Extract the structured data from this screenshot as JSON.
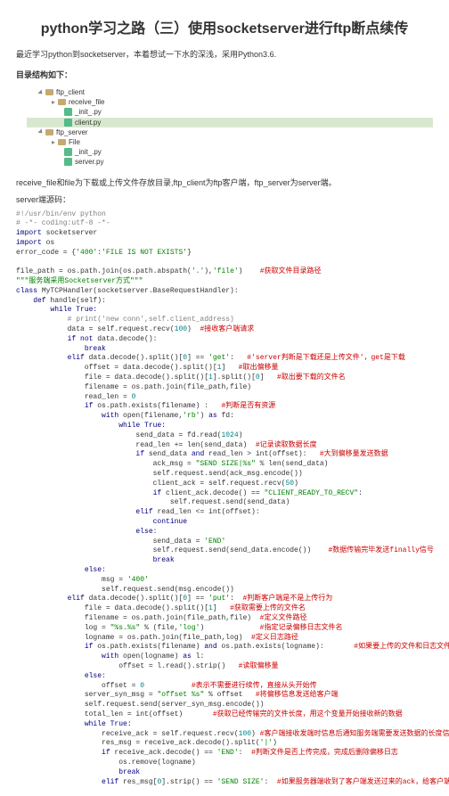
{
  "title": "python学习之路（三）使用socketserver进行ftp断点续传",
  "desc": "最近学习python到socketserver，本着想试一下水的深浅，采用Python3.6.",
  "struct_label": "目录结构如下：",
  "tree": {
    "root": "ftp_client",
    "recv": "receive_file",
    "init1": "_init_.py",
    "client": "client.py",
    "srv_root": "ftp_server",
    "file": "File",
    "init2": "_init_.py",
    "server": "server.py"
  },
  "caption": "receive_file和file为下载或上传文件存放目录,ftp_client为ftp客户端，ftp_server为server端。",
  "server_label": "server端源码：",
  "c": {
    "l1": "#!/usr/bin/env python",
    "l2": "# -*- coding:utf-8 -*-",
    "l3": "import",
    "l3b": " socketserver",
    "l4": "import",
    "l4b": " os",
    "l5a": "error_code = {",
    "l5b": "'400'",
    "l5c": ":",
    "l5d": "'FILE IS NOT EXISTS'",
    "l5e": "}",
    "l6a": "file_path = os.path.join(os.path.abspath(",
    "l6b": "'.'",
    "l6c": "),",
    "l6d": "'file'",
    "l6e": ")    ",
    "l6f": "#获取文件目录路径",
    "l7": "\"\"\"服务端采用Socketserver方式\"\"\"",
    "l8a": "class ",
    "l8b": "MyTCPHandler",
    "l8c": "(socketserver.BaseRequestHandler):",
    "l9a": "    def ",
    "l9b": "handle",
    "l9c": "(self):",
    "l10": "        while True:",
    "l11": "            # print('new conn',self.client_address)",
    "l12a": "            data = self.request.recv(",
    "l12b": "100",
    "l12c": ")  ",
    "l12d": "#接收客户端请求",
    "l13": "            if not ",
    "l13b": "data.decode():",
    "l14": "                break",
    "l15": "            elif ",
    "l15b": "data.decode().split()[",
    "l15c": "0",
    "l15d": "] == ",
    "l15e": "'get'",
    "l15f": ":   ",
    "l15g": "#'server判断是下载还是上传文件'，get是下载",
    "l16": "                offset = data.decode().split()[",
    "l16c": "1",
    "l16d": "]   ",
    "l16e": "#取出偏移量",
    "l17": "                file = data.decode().split()[",
    "l17c": "1",
    "l17d": "].split()[",
    "l17e": "0",
    "l17f": "]   ",
    "l17g": "#取出要下载的文件名",
    "l18": "                filename = os.path.join(file_path,file)",
    "l19": "                read_len = ",
    "l19b": "0",
    "l20": "                if ",
    "l20b": "os.path.exists(filename) :   ",
    "l20c": "#判断是否有资源",
    "l21": "                    with ",
    "l21b": "open(filename,",
    "l21c": "'rb'",
    "l21d": ") ",
    "l21e": "as ",
    "l21f": "fd:",
    "l22": "                        while True:",
    "l23": "                            send_data = fd.read(",
    "l23b": "1024",
    "l23c": ")",
    "l24": "                            read_len += len(send_data)  ",
    "l24b": "#记录读取数据长度",
    "l25": "                            if ",
    "l25b": "send_data ",
    "l25c": "and ",
    "l25d": "read_len > int(offset):   ",
    "l25e": "#大到偏移量发送数据",
    "l26": "                                ack_msg = ",
    "l26b": "\"SEND SIZE|%s\" ",
    "l26c": "% len(send_data)",
    "l27": "                                self.request.send(ack_msg.encode())",
    "l28": "                                client_ack = self.request.recv(",
    "l28b": "50",
    "l28c": ")",
    "l29": "                                if ",
    "l29b": "client_ack.decode() == ",
    "l29c": "\"CLIENT_READY_TO_RECV\"",
    "l29d": ":",
    "l30": "                                    self.request.send(send_data)",
    "l31": "                            elif ",
    "l31b": "read_len <= int(offset):",
    "l32": "                                continue",
    "l33": "                            else",
    "l33b": ":",
    "l34": "                                send_data = ",
    "l34b": "'END'",
    "l35": "                                self.request.send(send_data.encode())    ",
    "l35b": "#数据传输完毕发送finally信号",
    "l36": "                                break",
    "l37": "                else",
    "l37b": ":",
    "l38": "                    msg = ",
    "l38b": "'400'",
    "l39": "                    self.request.send(msg.encode())",
    "l40": "            elif ",
    "l40b": "data.decode().split()[",
    "l40c": "0",
    "l40d": "] == ",
    "l40e": "'put'",
    "l40f": ":  ",
    "l40g": "#判断客户端是不是上传行为",
    "l41": "                file = data.decode().split()[",
    "l41b": "1",
    "l41c": "]   ",
    "l41d": "#获取需要上传的文件名",
    "l42": "                filename = os.path.join(file_path,file)  ",
    "l42b": "#定义文件路径",
    "l43": "                log = ",
    "l43b": "\"%s.%s\" ",
    "l43c": "% (file,",
    "l43d": "'log'",
    "l43e": ")             ",
    "l43f": "#指定记录偏移日志文件名",
    "l44": "                logname = os.path.join(file_path,log)  ",
    "l44b": "#定义日志路径",
    "l45": "                if ",
    "l45b": "os.path.exists(filename) ",
    "l45c": "and ",
    "l45d": "os.path.exists(logname):       ",
    "l45e": "#如果要上传的文件和日志文件同时存在，说明需要进行续传",
    "l46": "                    with ",
    "l46b": "open(logname) ",
    "l46c": "as ",
    "l46d": "l:",
    "l47": "                        offset = l.read().strip()   ",
    "l47b": "#读取偏移量",
    "l48": "                else",
    "l48b": ":",
    "l49": "                    offset = ",
    "l49b": "0           ",
    "l49c": "#表示不需要进行续传，直接从头开始传",
    "l50": "                server_syn_msg = ",
    "l50b": "\"offset %s\" ",
    "l50c": "% offset   ",
    "l50d": "#将偏移信息发送给客户端",
    "l51": "                self.request.send(server_syn_msg.encode())",
    "l52": "                total_len = int(offset)       ",
    "l52b": "#获取已经传输完的文件长度，用这个变量开始接收新的数据",
    "l53": "                while True:",
    "l54": "                    receive_ack = self.request.recv(",
    "l54b": "100",
    "l54c": ") ",
    "l54d": "#客户端接收发端时信息后通知服务端需要发送数据的长度信息，相当于一个ack",
    "l55": "                    res_msg = receive_ack.decode().split(",
    "l55b": "'|'",
    "l55c": ")",
    "l56": "                    if ",
    "l56b": "receive_ack.decode() == ",
    "l56c": "'END'",
    "l56d": ":  ",
    "l56e": "#判断文件是否上传完成，完成后删除偏移日志",
    "l57": "                        os.remove(logname)",
    "l58": "                        break",
    "l59": "                    elif ",
    "l59b": "res_msg[",
    "l59c": "0",
    "l59d": "].strip() == ",
    "l59e": "'SEND SIZE'",
    "l59f": ":  ",
    "l59g": "#如果服务器端收到了客户端发送过来的ack，给客户端返回一个syn信息，表示可以开始传数据了"
  }
}
